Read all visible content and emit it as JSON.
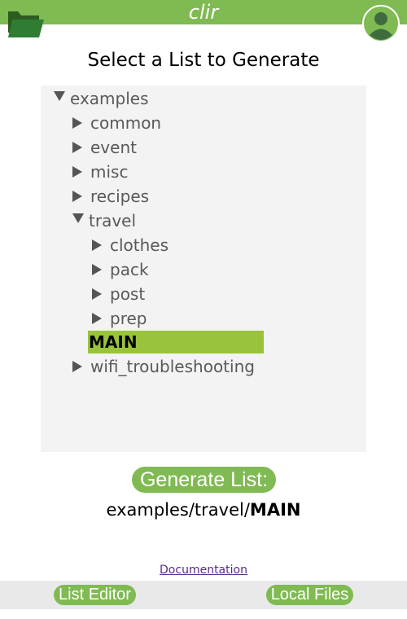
{
  "header": {
    "title": "clir",
    "brand_color": "#7fba52",
    "folder_icon": "folder-open-icon",
    "avatar_icon": "user-avatar-icon"
  },
  "page": {
    "heading": "Select a List to Generate"
  },
  "tree": {
    "root": {
      "label": "examples",
      "expanded": true
    },
    "items": [
      {
        "label": "common",
        "expanded": false
      },
      {
        "label": "event",
        "expanded": false
      },
      {
        "label": "misc",
        "expanded": false
      },
      {
        "label": "recipes",
        "expanded": false
      },
      {
        "label": "travel",
        "expanded": true
      },
      {
        "label": "clothes",
        "expanded": false
      },
      {
        "label": "pack",
        "expanded": false
      },
      {
        "label": "post",
        "expanded": false
      },
      {
        "label": "prep",
        "expanded": false
      },
      {
        "label": "MAIN",
        "selected": true
      },
      {
        "label": "wifi_troubleshooting",
        "expanded": false
      }
    ],
    "selected_color": "#99c33a"
  },
  "generate": {
    "button_label": "Generate List:",
    "path_prefix": "examples/travel/",
    "path_selected": "MAIN"
  },
  "links": {
    "documentation": "Documentation"
  },
  "footer": {
    "list_editor": "List Editor",
    "local_files": "Local Files"
  }
}
